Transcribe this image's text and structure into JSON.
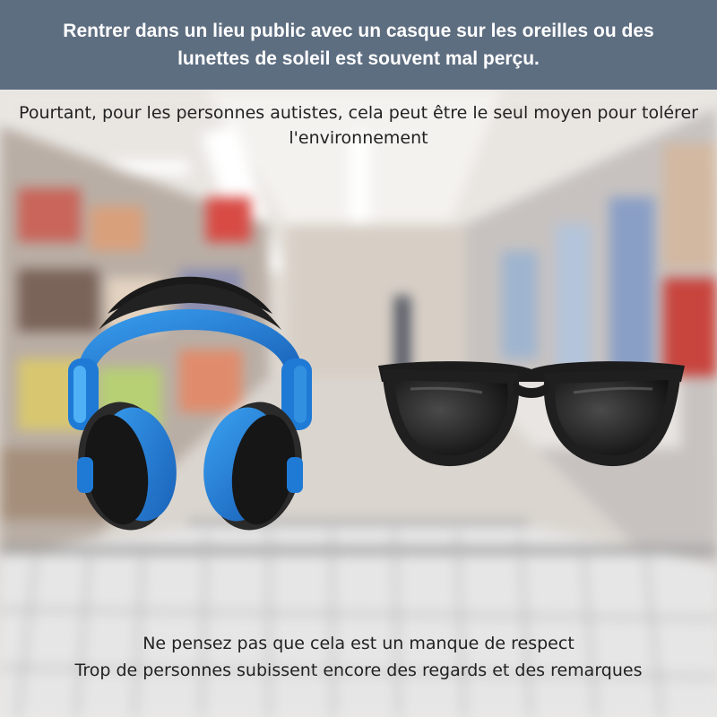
{
  "header": {
    "title": "Rentrer dans un lieu public avec un casque sur les oreilles ou des lunettes de soleil est souvent mal perçu."
  },
  "subtitle": {
    "text": "Pourtant, pour les personnes autistes, cela peut être le seul moyen pour tolérer l'environnement"
  },
  "footer": {
    "line1": "Ne pensez pas que cela est un manque de respect",
    "line2": "Trop de personnes subissent encore des regards et des remarques"
  },
  "icons": {
    "headphones": "headphones-icon",
    "sunglasses": "sunglasses-icon"
  },
  "colors": {
    "header_bg": "#5e6e81",
    "header_text": "#ffffff",
    "headphone_blue": "#1e7fd8",
    "lens_dark": "#1a1a1a"
  }
}
